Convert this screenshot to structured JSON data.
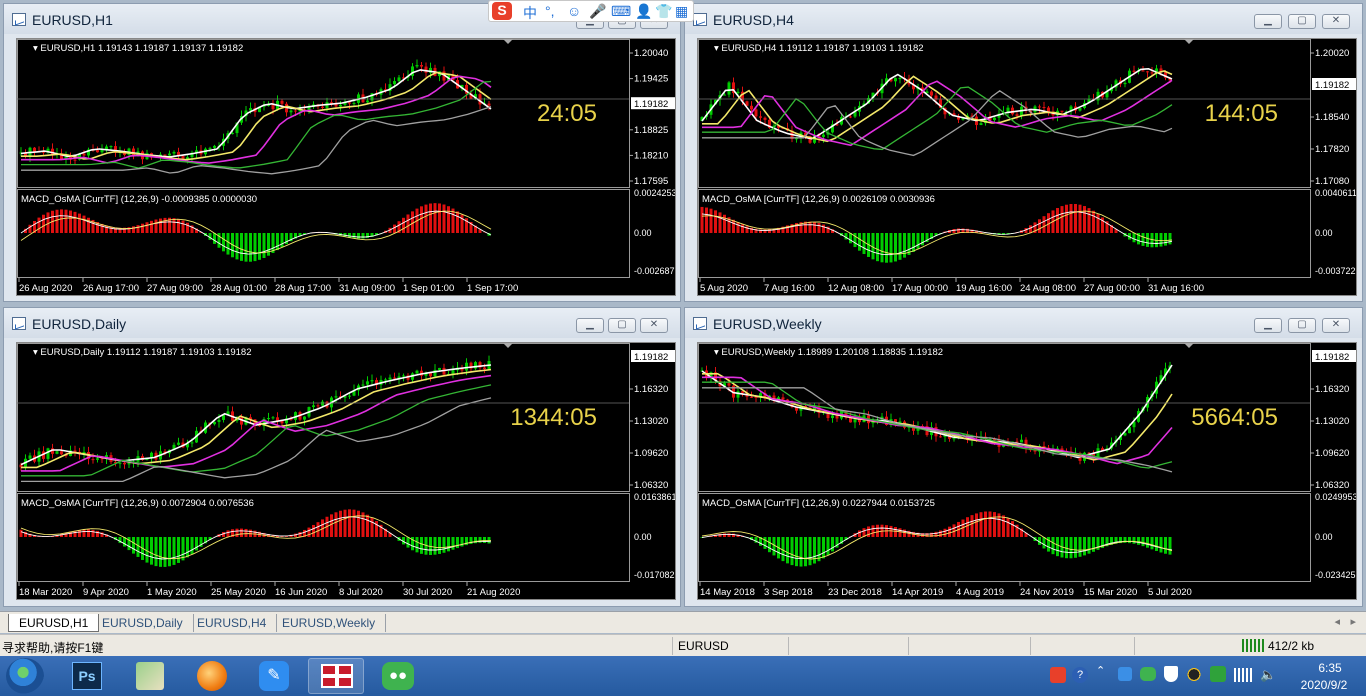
{
  "windows": [
    {
      "title": "EURUSD,H1",
      "info": "EURUSD,H1  1.19143 1.19187 1.19137 1.19182",
      "timer": "24:05",
      "prices": [
        "1.20040",
        "1.19425",
        "1.19182",
        "1.18825",
        "1.18210",
        "1.17595"
      ],
      "macd_label": "MACD_OsMA [CurrTF] (12,26,9) -0.0009385 0.0000030",
      "macd_scale": [
        "0.0024253",
        "0.00",
        "-0.002687"
      ],
      "dates": [
        "26 Aug 2020",
        "26 Aug 17:00",
        "27 Aug 09:00",
        "28 Aug 01:00",
        "28 Aug 17:00",
        "31 Aug 09:00",
        "1 Sep 01:00",
        "1 Sep 17:00"
      ]
    },
    {
      "title": "EURUSD,H4",
      "info": "EURUSD,H4  1.19112 1.19187 1.19103 1.19182",
      "timer": "144:05",
      "prices": [
        "1.20020",
        "1.19182",
        "1.18540",
        "1.17820",
        "1.17080"
      ],
      "macd_label": "MACD_OsMA [CurrTF] (12,26,9) 0.0026109 0.0030936",
      "macd_scale": [
        "0.0040611",
        "0.00",
        "-0.003722"
      ],
      "dates": [
        "5 Aug 2020",
        "7 Aug 16:00",
        "12 Aug 08:00",
        "17 Aug 00:00",
        "19 Aug 16:00",
        "24 Aug 08:00",
        "27 Aug 00:00",
        "31 Aug 16:00"
      ]
    },
    {
      "title": "EURUSD,Daily",
      "info": "EURUSD,Daily  1.19112 1.19187 1.19103 1.19182",
      "timer": "1344:05",
      "prices": [
        "1.19182",
        "1.16320",
        "1.13020",
        "1.09620",
        "1.06320"
      ],
      "macd_label": "MACD_OsMA [CurrTF] (12,26,9) 0.0072904 0.0076536",
      "macd_scale": [
        "0.0163861",
        "0.00",
        "-0.017082"
      ],
      "dates": [
        "18 Mar 2020",
        "9 Apr 2020",
        "1 May 2020",
        "25 May 2020",
        "16 Jun 2020",
        "8 Jul 2020",
        "30 Jul 2020",
        "21 Aug 2020"
      ]
    },
    {
      "title": "EURUSD,Weekly",
      "info": "EURUSD,Weekly  1.18989 1.20108 1.18835 1.19182",
      "timer": "5664:05",
      "prices": [
        "1.19182",
        "1.16320",
        "1.13020",
        "1.09620",
        "1.06320"
      ],
      "macd_label": "MACD_OsMA [CurrTF] (12,26,9) 0.0227944 0.0153725",
      "macd_scale": [
        "0.0249953",
        "0.00",
        "-0.023425"
      ],
      "dates": [
        "14 May 2018",
        "3 Sep 2018",
        "23 Dec 2018",
        "14 Apr 2019",
        "4 Aug 2019",
        "24 Nov 2019",
        "15 Mar 2020",
        "5 Jul 2020"
      ]
    }
  ],
  "tabs": [
    "EURUSD,H1",
    "EURUSD,Daily",
    "EURUSD,H4",
    "EURUSD,Weekly"
  ],
  "status": {
    "help": "寻求帮助,请按F1键",
    "profile": "EURUSD",
    "traffic": "412/2 kb"
  },
  "ime": {
    "mode": "中",
    "punct": "°,"
  },
  "clock": {
    "time": "6:35",
    "date": "2020/9/2"
  },
  "colors": {
    "bull": "#00cc00",
    "bear": "#e01010",
    "timer": "#e8d24a",
    "ma_white": "#ffffff",
    "ma_yellow": "#f3e86a",
    "ma_magenta": "#e030e0",
    "ma_green": "#34b534",
    "ma_gray": "#a0a0a0"
  },
  "icons": [
    "start-orb-icon",
    "photoshop-icon",
    "map-app-icon",
    "browser-icon",
    "notes-icon",
    "metatrader-icon",
    "wechat-icon"
  ]
}
